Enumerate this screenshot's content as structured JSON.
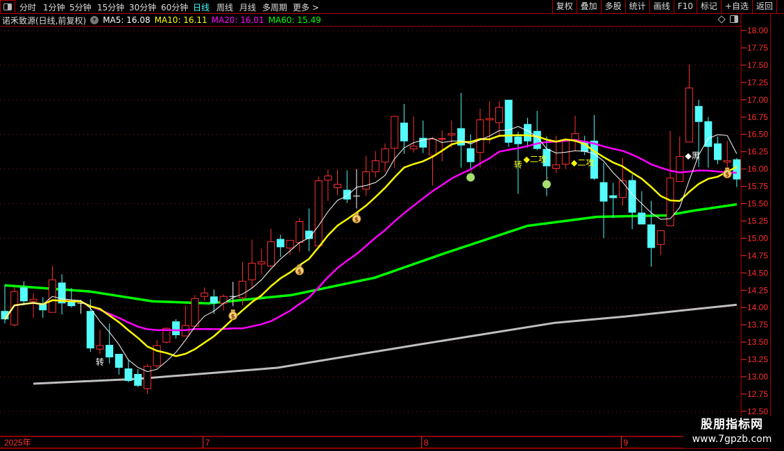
{
  "toolbar": {
    "periods": [
      "分时",
      "1分钟",
      "5分钟",
      "15分钟",
      "30分钟",
      "60分钟",
      "日线",
      "周线",
      "月线",
      "多周期",
      "更多 >"
    ],
    "active_period": "日线",
    "buttons": [
      "复权",
      "叠加",
      "多股",
      "统计",
      "画线",
      "F10",
      "标记",
      "+自选",
      "返回"
    ]
  },
  "info": {
    "title": "诺禾致源(日线,前复权)",
    "ma5": "MA5: 16.08",
    "ma10": "MA10: 16.11",
    "ma20": "MA20: 16.01",
    "ma60": "MA60: 15.49"
  },
  "watermark": {
    "line1": "股朋指标网",
    "line2": "www.7gpzb.com"
  },
  "colors": {
    "up": "#ff3030",
    "down": "#54fcfc",
    "ma5": "#ffffff",
    "ma10": "#ffff00",
    "ma20": "#ff00ff",
    "ma60": "#00ff00",
    "ma250": "#bfbfbf",
    "axis": "#ff3030",
    "grid": "#8a1010"
  },
  "chart_data": {
    "type": "candlestick",
    "y_ticks": [
      "18.00",
      "17.75",
      "17.50",
      "17.25",
      "17.00",
      "16.75",
      "16.50",
      "16.25",
      "16.00",
      "15.75",
      "15.50",
      "15.25",
      "15.00",
      "14.75",
      "14.50",
      "14.25",
      "14.00",
      "13.75",
      "13.50",
      "13.25",
      "13.00",
      "12.75",
      "12.50"
    ],
    "ylim": [
      12.5,
      18.0
    ],
    "x_labels": [
      {
        "index": 0,
        "label": "2025年"
      },
      {
        "index": 21,
        "label": "7"
      },
      {
        "index": 44,
        "label": "8"
      },
      {
        "index": 65,
        "label": "9"
      }
    ],
    "ohlc": [
      [
        13.95,
        14.33,
        13.77,
        13.83
      ],
      [
        13.75,
        14.3,
        13.73,
        14.23
      ],
      [
        14.29,
        14.38,
        14.03,
        14.09
      ],
      [
        14.09,
        14.21,
        13.85,
        14.12
      ],
      [
        14.05,
        14.15,
        13.85,
        13.96
      ],
      [
        13.93,
        14.6,
        13.93,
        14.4
      ],
      [
        14.36,
        14.48,
        13.9,
        14.06
      ],
      [
        14.09,
        14.28,
        14.0,
        14.02
      ],
      [
        14.06,
        14.11,
        13.91,
        14.06
      ],
      [
        13.95,
        14.12,
        13.36,
        13.41
      ],
      [
        13.4,
        13.68,
        13.33,
        13.45
      ],
      [
        13.46,
        13.77,
        13.19,
        13.28
      ],
      [
        13.33,
        13.33,
        13.03,
        13.13
      ],
      [
        13.12,
        13.24,
        12.92,
        12.94
      ],
      [
        13.04,
        13.11,
        12.85,
        12.87
      ],
      [
        12.83,
        13.18,
        12.75,
        13.15
      ],
      [
        13.16,
        13.53,
        13.13,
        13.45
      ],
      [
        13.5,
        13.71,
        13.48,
        13.7
      ],
      [
        13.8,
        13.83,
        13.55,
        13.6
      ],
      [
        13.59,
        14.03,
        13.59,
        13.74
      ],
      [
        13.73,
        14.18,
        13.73,
        14.13
      ],
      [
        14.16,
        14.29,
        14.1,
        14.21
      ],
      [
        14.16,
        14.26,
        13.91,
        14.06
      ],
      [
        14.06,
        14.19,
        13.96,
        14.16
      ],
      [
        14.16,
        14.37,
        14.02,
        14.16
      ],
      [
        14.14,
        14.66,
        14.03,
        14.38
      ],
      [
        14.4,
        14.98,
        14.28,
        14.64
      ],
      [
        14.63,
        14.85,
        14.48,
        14.66
      ],
      [
        14.6,
        15.14,
        14.58,
        14.95
      ],
      [
        14.99,
        15.05,
        14.73,
        14.87
      ],
      [
        14.86,
        14.97,
        14.76,
        14.97
      ],
      [
        14.94,
        15.29,
        14.81,
        15.24
      ],
      [
        15.11,
        15.43,
        14.81,
        14.99
      ],
      [
        14.89,
        15.89,
        14.89,
        15.83
      ],
      [
        15.84,
        15.99,
        15.54,
        15.9
      ],
      [
        15.73,
        15.99,
        15.62,
        15.78
      ],
      [
        15.7,
        15.98,
        15.51,
        15.56
      ],
      [
        15.61,
        16.0,
        15.43,
        15.61
      ],
      [
        15.71,
        16.19,
        15.61,
        15.96
      ],
      [
        15.96,
        16.26,
        15.88,
        16.12
      ],
      [
        16.1,
        16.37,
        15.96,
        16.29
      ],
      [
        16.3,
        16.76,
        16.02,
        16.76
      ],
      [
        16.67,
        16.94,
        16.22,
        16.4
      ],
      [
        16.29,
        16.76,
        16.24,
        16.33
      ],
      [
        16.45,
        16.7,
        16.23,
        16.31
      ],
      [
        16.2,
        16.46,
        15.76,
        16.43
      ],
      [
        16.43,
        16.56,
        16.11,
        16.44
      ],
      [
        16.49,
        16.7,
        16.31,
        16.51
      ],
      [
        16.59,
        17.1,
        16.02,
        16.34
      ],
      [
        16.3,
        16.5,
        16.01,
        16.1
      ],
      [
        16.24,
        16.87,
        16.02,
        16.71
      ],
      [
        16.71,
        16.98,
        16.36,
        16.73
      ],
      [
        16.67,
        16.98,
        16.46,
        16.89
      ],
      [
        17.0,
        17.0,
        16.32,
        16.38
      ],
      [
        16.47,
        16.54,
        15.64,
        16.36
      ],
      [
        16.65,
        16.74,
        16.31,
        16.4
      ],
      [
        16.55,
        16.84,
        16.27,
        16.29
      ],
      [
        16.29,
        16.47,
        15.61,
        16.04
      ],
      [
        16.01,
        16.48,
        15.94,
        16.06
      ],
      [
        16.07,
        16.43,
        16.0,
        16.42
      ],
      [
        16.41,
        16.77,
        16.26,
        16.51
      ],
      [
        16.4,
        16.48,
        16.2,
        16.25
      ],
      [
        16.41,
        16.78,
        15.84,
        15.86
      ],
      [
        15.81,
        16.09,
        15.0,
        15.53
      ],
      [
        15.62,
        15.8,
        15.29,
        15.58
      ],
      [
        15.59,
        16.16,
        15.47,
        15.83
      ],
      [
        15.84,
        15.92,
        15.13,
        15.37
      ],
      [
        15.37,
        15.68,
        15.2,
        15.2
      ],
      [
        15.2,
        15.54,
        14.59,
        14.86
      ],
      [
        14.91,
        15.11,
        14.76,
        15.11
      ],
      [
        15.18,
        16.55,
        15.18,
        15.87
      ],
      [
        15.82,
        16.47,
        15.82,
        16.18
      ],
      [
        16.39,
        17.51,
        16.39,
        17.17
      ],
      [
        16.91,
        17.0,
        16.03,
        16.68
      ],
      [
        16.69,
        16.75,
        16.02,
        16.32
      ],
      [
        16.37,
        16.47,
        16.07,
        16.13
      ],
      [
        16.1,
        16.41,
        15.94,
        16.12
      ],
      [
        16.14,
        16.16,
        15.74,
        15.85
      ]
    ],
    "ma60_points": [
      [
        0,
        14.32
      ],
      [
        9,
        14.23
      ],
      [
        15.5,
        14.09
      ],
      [
        21.4,
        14.06
      ],
      [
        30.2,
        14.18
      ],
      [
        38.9,
        14.43
      ],
      [
        46.2,
        14.78
      ],
      [
        55,
        15.18
      ],
      [
        62.3,
        15.31
      ],
      [
        69.6,
        15.33
      ],
      [
        72.5,
        15.4
      ],
      [
        77,
        15.49
      ]
    ],
    "ma250_points": [
      [
        3,
        12.9
      ],
      [
        14,
        12.97
      ],
      [
        28.7,
        13.13
      ],
      [
        43.3,
        13.46
      ],
      [
        57.9,
        13.78
      ],
      [
        65.2,
        13.87
      ],
      [
        77,
        14.04
      ]
    ],
    "markers": [
      {
        "index": 10,
        "price": 13.22,
        "type": "text",
        "text": "转",
        "color": "#ffffff"
      },
      {
        "index": 24,
        "price": 13.9,
        "type": "money-bag"
      },
      {
        "index": 31,
        "price": 14.55,
        "type": "money-bag"
      },
      {
        "index": 37,
        "price": 15.3,
        "type": "money-bag"
      },
      {
        "index": 76,
        "price": 15.95,
        "type": "money-bag"
      },
      {
        "index": 49,
        "price": 15.9,
        "type": "apple"
      },
      {
        "index": 57,
        "price": 15.8,
        "type": "apple"
      },
      {
        "index": 54,
        "price": 16.07,
        "type": "text",
        "text": "转",
        "color": "#ffff00"
      },
      {
        "index": 55,
        "price": 16.15,
        "type": "text",
        "text": "◆二攻",
        "color": "#ffff00"
      },
      {
        "index": 60,
        "price": 16.1,
        "type": "text",
        "text": "◆二攻",
        "color": "#ffff00"
      },
      {
        "index": 72,
        "price": 16.2,
        "type": "text",
        "text": "◆黑",
        "color": "#ffffff"
      }
    ]
  }
}
